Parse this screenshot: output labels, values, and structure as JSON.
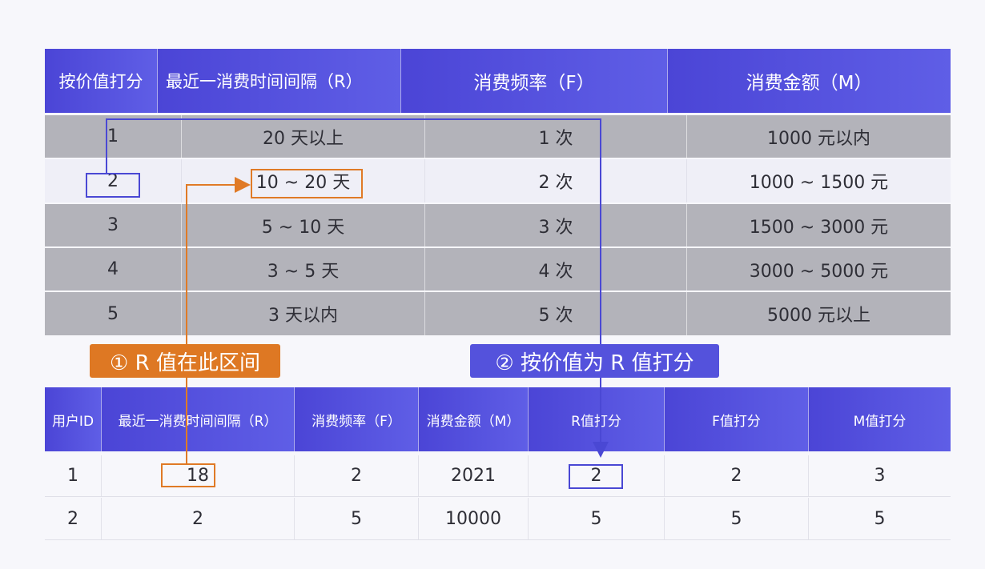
{
  "top_table": {
    "headers": [
      "按价值打分",
      "最近一消费时间间隔（R）",
      "消费频率（F）",
      "消费金额（M）"
    ],
    "rows": [
      [
        "1",
        "20 天以上",
        "1 次",
        "1000 元以内"
      ],
      [
        "2",
        "10 ~ 20 天",
        "2 次",
        "1000 ~ 1500 元"
      ],
      [
        "3",
        "5 ~ 10 天",
        "3 次",
        "1500 ~ 3000 元"
      ],
      [
        "4",
        "3 ~ 5 天",
        "4 次",
        "3000 ~ 5000 元"
      ],
      [
        "5",
        "3 天以内",
        "5 次",
        "5000 元以上"
      ]
    ]
  },
  "annotations": {
    "step1": "① R 值在此区间",
    "step2": "② 按价值为 R 值打分"
  },
  "bottom_table": {
    "headers": [
      "用户ID",
      "最近一消费时间间隔（R）",
      "消费频率（F）",
      "消费金额（M）",
      "R值打分",
      "F值打分",
      "M值打分"
    ],
    "rows": [
      [
        "1",
        "18",
        "2",
        "2021",
        "2",
        "2",
        "3"
      ],
      [
        "2",
        "2",
        "5",
        "10000",
        "5",
        "5",
        "5"
      ]
    ]
  },
  "colors": {
    "header_blue": "#4b45d6",
    "accent_orange": "#e07a26",
    "accent_blue": "#4a48d4",
    "row_gray": "#b3b3ba"
  }
}
